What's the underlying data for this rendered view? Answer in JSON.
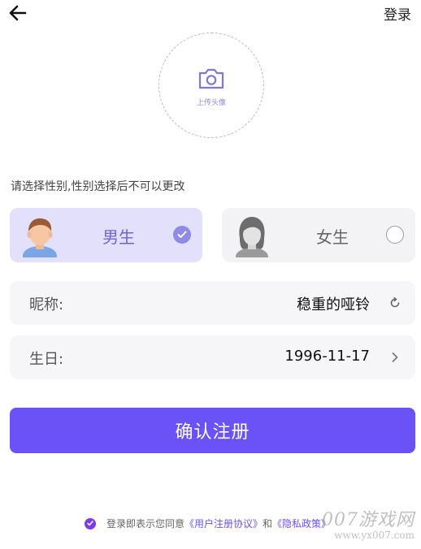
{
  "header": {
    "back_icon": "arrow-left-icon",
    "login_label": "登录"
  },
  "avatar_upload": {
    "icon": "camera-icon",
    "label": "上传头像"
  },
  "gender": {
    "hint": "请选择性别,性别选择后不可以更改",
    "options": [
      {
        "label": "男生",
        "selected": true,
        "icon": "male-avatar-icon"
      },
      {
        "label": "女生",
        "selected": false,
        "icon": "female-avatar-icon"
      }
    ]
  },
  "form": {
    "nickname": {
      "label": "昵称:",
      "value": "稳重的哑铃",
      "action_icon": "refresh-icon"
    },
    "birthday": {
      "label": "生日:",
      "value": "1996-11-17",
      "action_icon": "chevron-right-icon"
    }
  },
  "confirm_button": {
    "label": "确认注册"
  },
  "agreement": {
    "prefix": "登录即表示您同意",
    "user_agreement": "《用户注册协议》",
    "conjunction": "和",
    "privacy_policy": "《隐私政策》",
    "checked": true
  },
  "watermark": {
    "main": "007游戏网",
    "url": "www.yx007.com"
  },
  "colors": {
    "accent": "#6a52f6",
    "selected_card": "#e2e0fa",
    "row_bg": "#f6f6f8"
  }
}
